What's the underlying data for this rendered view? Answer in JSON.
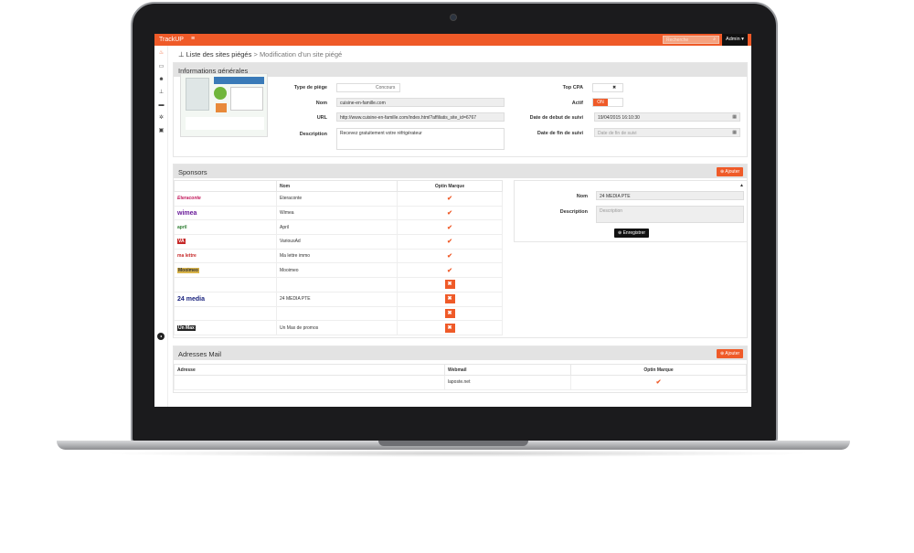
{
  "app": {
    "brand": "TrackUP",
    "menu_icon": "hamburger-icon",
    "search_placeholder": "Recherche",
    "admin_label": "Admin ▾"
  },
  "sidebar_icons": [
    "flame-icon",
    "card-icon",
    "users-icon",
    "sitemap-icon",
    "laptop-icon",
    "cogs-icon",
    "save-icon"
  ],
  "breadcrumb": {
    "link": "Liste des sites piégés",
    "separator": ">",
    "current": "Modification d'un site piégé"
  },
  "info": {
    "title": "Informations générales",
    "type_label": "Type de piège",
    "type_value": "Concours",
    "nom_label": "Nom",
    "nom_value": "cuisine-en-famille.com",
    "url_label": "URL",
    "url_value": "http://www.cuisine-en-famille.com/index.html?affiliatis_site_id=6767",
    "desc_label": "Description",
    "desc_value": "Recevez gratuitement votre réfrigérateur",
    "topcpa_label": "Top CPA",
    "topcpa_x": "✖",
    "actif_label": "Actif",
    "actif_on": "ON",
    "debut_label": "Date de debut de suivi",
    "debut_value": "19/04/2015 16:10:30",
    "fin_label": "Date de fin de suivi",
    "fin_placeholder": "Date de fin de suivi"
  },
  "sponsors": {
    "title": "Sponsors",
    "add_label": "⊕ Ajouter",
    "col_nom": "Nom",
    "col_optin": "Optin Marque",
    "rows": [
      {
        "logo": "Eteraconte",
        "name": "Eteraconte",
        "optin": "check"
      },
      {
        "logo": "wimea",
        "name": "Wimea",
        "optin": "check"
      },
      {
        "logo": "april",
        "name": "April",
        "optin": "check"
      },
      {
        "logo": "VA",
        "name": "VariousAd",
        "optin": "check"
      },
      {
        "logo": "ma lettre",
        "name": "Ma lettre immo",
        "optin": "check"
      },
      {
        "logo": "Mooimeo",
        "name": "Mooimeo",
        "optin": "check"
      },
      {
        "logo": "",
        "name": "",
        "optin": "x"
      },
      {
        "logo": "24 media",
        "name": "24 MEDIA PTE",
        "optin": "x"
      },
      {
        "logo": "",
        "name": "",
        "optin": "x"
      },
      {
        "logo": "Un Max",
        "name": "Un Max de promos",
        "optin": "x"
      }
    ],
    "detail": {
      "nom_label": "Nom",
      "nom_value": "24 MEDIA PTE",
      "desc_label": "Description",
      "desc_placeholder": "Description",
      "btn_label": "⊕ Enregistrer"
    }
  },
  "mail": {
    "title": "Adresses Mail",
    "add_label": "⊕ Ajouter",
    "col_adresse": "Adresse",
    "col_webmail": "Webmail",
    "col_optin": "Optin Marque",
    "rows": [
      {
        "adresse": "",
        "webmail": "laposte.net",
        "optin": "check"
      }
    ]
  }
}
